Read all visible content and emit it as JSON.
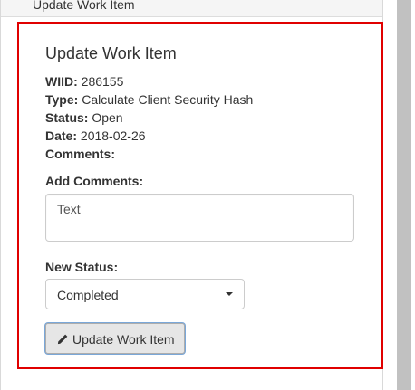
{
  "panel": {
    "header_title": "Update Work Item"
  },
  "form": {
    "title": "Update Work Item",
    "fields": {
      "wiid_label": "WIID:",
      "wiid_value": "286155",
      "type_label": "Type:",
      "type_value": "Calculate Client Security Hash",
      "status_label": "Status:",
      "status_value": "Open",
      "date_label": "Date:",
      "date_value": "2018-02-26",
      "comments_label": "Comments:"
    },
    "add_comments_label": "Add Comments:",
    "comments_placeholder": "Text",
    "new_status_label": "New Status:",
    "new_status_value": "Completed",
    "submit_label": "Update Work Item",
    "submit_icon": "pencil-icon"
  },
  "colors": {
    "highlight_border": "#e00000",
    "button_bg": "#e6e6e6",
    "button_focus": "#7aa7d8"
  }
}
